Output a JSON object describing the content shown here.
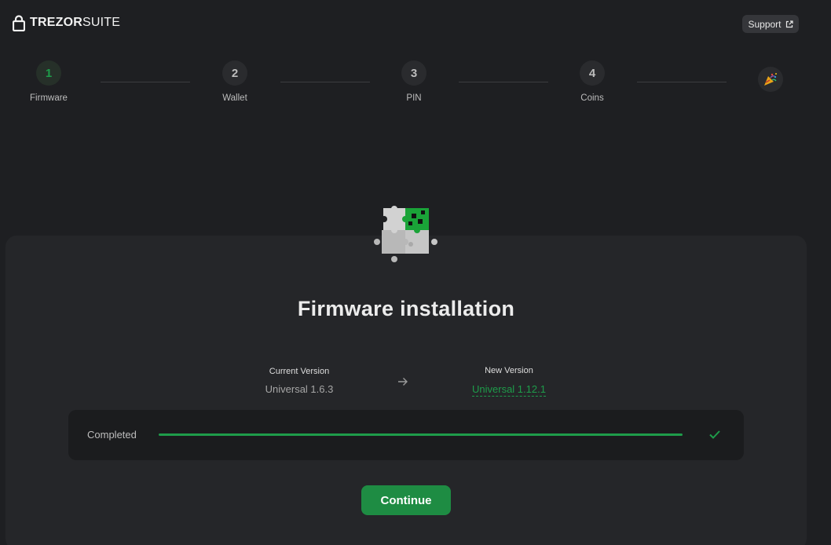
{
  "header": {
    "logo_bold": "TREZOR",
    "logo_light": "SUITE",
    "support_label": "Support",
    "support_icon": "external-link-icon"
  },
  "stepper": {
    "steps": [
      {
        "number": "1",
        "label": "Firmware",
        "active": true
      },
      {
        "number": "2",
        "label": "Wallet",
        "active": false
      },
      {
        "number": "3",
        "label": "PIN",
        "active": false
      },
      {
        "number": "4",
        "label": "Coins",
        "active": false
      }
    ],
    "final_icon": "party-popper-icon"
  },
  "main": {
    "illustration": "puzzle-icon",
    "title": "Firmware installation",
    "current_version_label": "Current Version",
    "current_version": "Universal 1.6.3",
    "new_version_label": "New Version",
    "new_version": "Universal 1.12.1",
    "arrow_icon": "arrow-right-icon",
    "progress": {
      "label": "Completed",
      "value": 1.0,
      "status_icon": "checkmark-icon"
    },
    "continue_label": "Continue"
  },
  "colors": {
    "background": "#1e1f22",
    "card": "#252629",
    "accent_green": "#1e9c4a",
    "button_green": "#1e8c43"
  }
}
